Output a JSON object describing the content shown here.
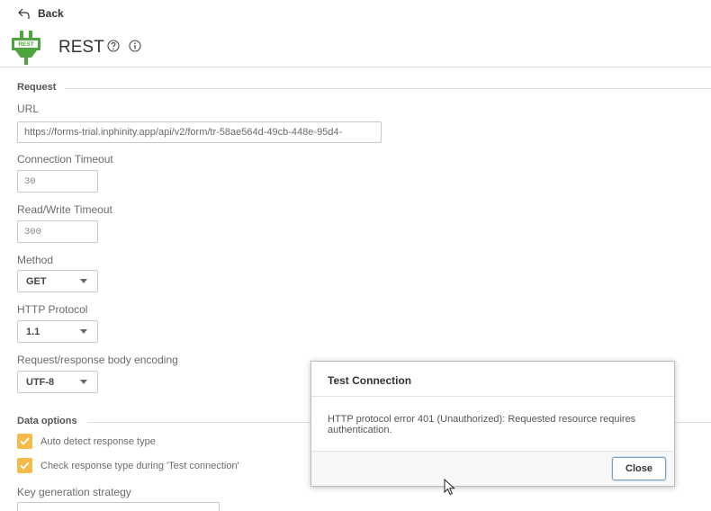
{
  "nav": {
    "back_label": "Back"
  },
  "header": {
    "title": "REST",
    "logo_text": "REST"
  },
  "request": {
    "section_label": "Request",
    "url": {
      "label": "URL",
      "value": "https://forms-trial.inphinity.app/api/v2/form/tr-58ae564d-49cb-448e-95d4-"
    },
    "connection_timeout": {
      "label": "Connection Timeout",
      "value": "30"
    },
    "rw_timeout": {
      "label": "Read/Write Timeout",
      "value": "300"
    },
    "method": {
      "label": "Method",
      "value": "GET"
    },
    "http_protocol": {
      "label": "HTTP Protocol",
      "value": "1.1"
    },
    "encoding": {
      "label": "Request/response body encoding",
      "value": "UTF-8"
    }
  },
  "data_options": {
    "section_label": "Data options",
    "auto_detect": {
      "label": "Auto detect response type",
      "checked": true
    },
    "check_type": {
      "label": "Check response type during 'Test connection'",
      "checked": true
    },
    "key_strategy": {
      "label": "Key generation strategy"
    }
  },
  "dialog": {
    "title": "Test Connection",
    "message": "HTTP protocol error 401 (Unauthorized): Requested resource requires authentication.",
    "close_label": "Close"
  },
  "colors": {
    "checkbox": "#f5bb4a",
    "logo_green": "#4ea53d"
  }
}
